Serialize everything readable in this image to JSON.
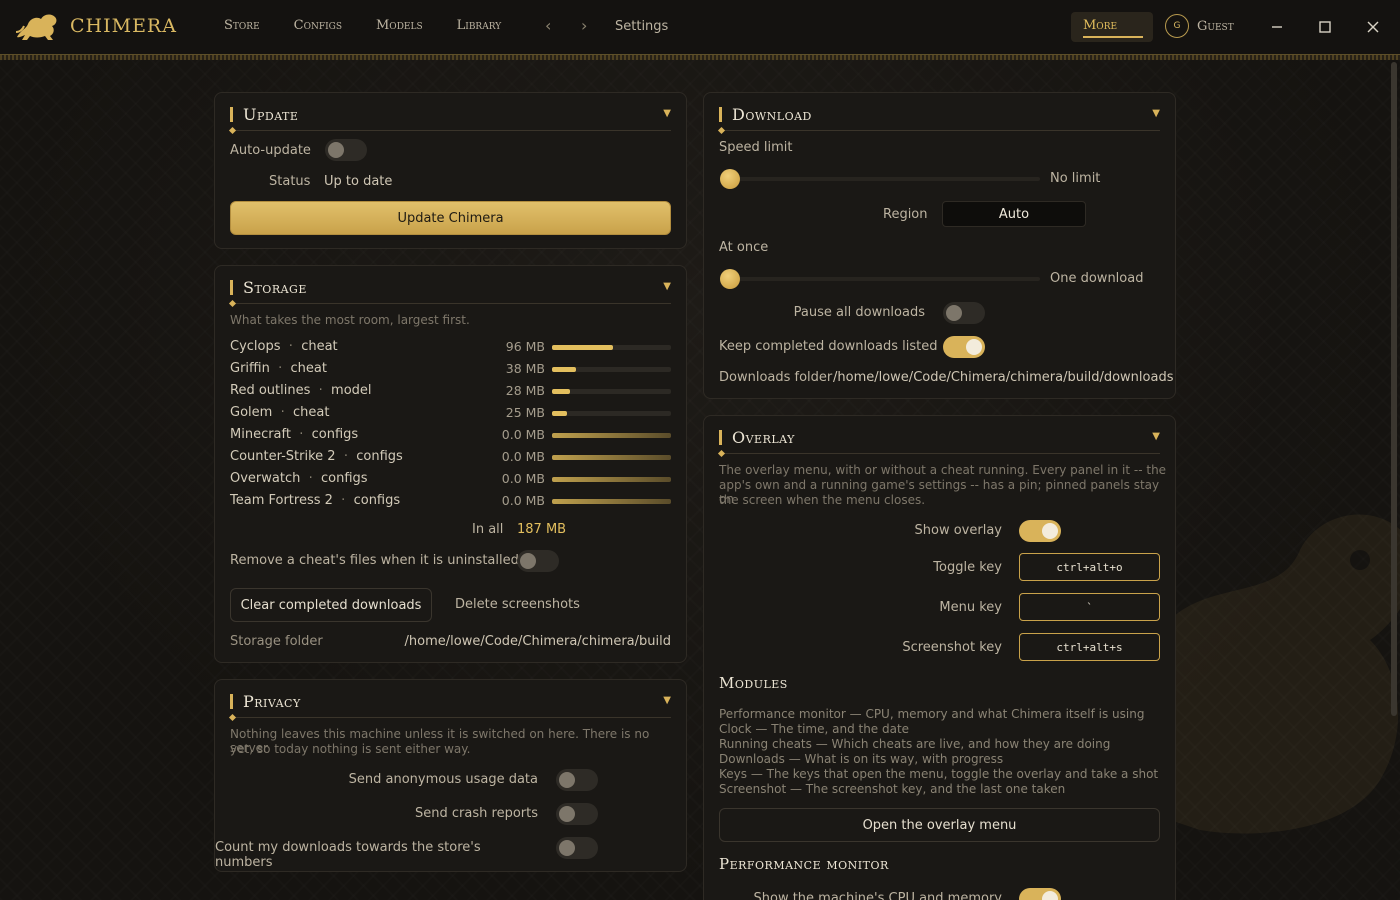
{
  "app": {
    "name": "CHIMERA"
  },
  "nav": [
    "Store",
    "Configs",
    "Models",
    "Library"
  ],
  "breadcrumb": "Settings",
  "topbar": {
    "more_label": "More",
    "user_initial": "G",
    "user_label": "Guest"
  },
  "colors": {
    "accent": "#d9b35a",
    "background": "#171512",
    "panel": "#1a1815"
  },
  "update": {
    "title": "Update",
    "auto_update_label": "Auto-update",
    "auto_update_on": false,
    "status_label": "Status",
    "status_value": "Up to date",
    "button": "Update Chimera"
  },
  "storage": {
    "title": "Storage",
    "subtitle": "What takes the most room, largest first.",
    "items": [
      {
        "name": "Cyclops",
        "kind": "cheat",
        "size": "96 MB",
        "fraction": 0.51
      },
      {
        "name": "Griffin",
        "kind": "cheat",
        "size": "38 MB",
        "fraction": 0.2
      },
      {
        "name": "Red outlines",
        "kind": "model",
        "size": "28 MB",
        "fraction": 0.15
      },
      {
        "name": "Golem",
        "kind": "cheat",
        "size": "25 MB",
        "fraction": 0.13
      },
      {
        "name": "Minecraft",
        "kind": "configs",
        "size": "0.0 MB",
        "fraction": 1.0
      },
      {
        "name": "Counter-Strike 2",
        "kind": "configs",
        "size": "0.0 MB",
        "fraction": 1.0
      },
      {
        "name": "Overwatch",
        "kind": "configs",
        "size": "0.0 MB",
        "fraction": 1.0
      },
      {
        "name": "Team Fortress 2",
        "kind": "configs",
        "size": "0.0 MB",
        "fraction": 1.0
      }
    ],
    "total_label": "In all",
    "total_value": "187 MB",
    "remove_label": "Remove a cheat's files when it is uninstalled",
    "remove_on": false,
    "clear_button": "Clear completed downloads",
    "delete_button": "Delete screenshots",
    "folder_label": "Storage folder",
    "folder_value": "/home/lowe/Code/Chimera/chimera/build"
  },
  "privacy": {
    "title": "Privacy",
    "description_1": "Nothing leaves this machine unless it is switched on here. There is no server",
    "description_2": "yet, so today nothing is sent either way.",
    "usage_label": "Send anonymous usage data",
    "crash_label": "Send crash reports",
    "count_label": "Count my downloads towards the store's numbers"
  },
  "download": {
    "title": "Download",
    "speed_label": "Speed limit",
    "speed_value": "No limit",
    "region_label": "Region",
    "region_value": "Auto",
    "at_once_label": "At once",
    "at_once_value": "One download",
    "pause_label": "Pause all downloads",
    "pause_on": false,
    "keep_label": "Keep completed downloads listed",
    "keep_on": true,
    "folder_label": "Downloads folder",
    "folder_value": "/home/lowe/Code/Chimera/chimera/build/downloads"
  },
  "overlay": {
    "title": "Overlay",
    "description_1": "The overlay menu, with or without a cheat running. Every panel in it -- the",
    "description_2": "app's own and a running game's settings -- has a pin; pinned panels stay on",
    "description_3": "the screen when the menu closes.",
    "show_label": "Show overlay",
    "show_on": true,
    "toggle_key_label": "Toggle key",
    "toggle_key_value": "ctrl+alt+o",
    "menu_key_label": "Menu key",
    "menu_key_value": "`",
    "screenshot_key_label": "Screenshot key",
    "screenshot_key_value": "ctrl+alt+s",
    "modules_title": "Modules",
    "modules": [
      "Performance monitor — CPU, memory and what Chimera itself is using",
      "Clock — The time, and the date",
      "Running cheats — Which cheats are live, and how they are doing",
      "Downloads — What is on its way, with progress",
      "Keys — The keys that open the menu, toggle the overlay and take a shot",
      "Screenshot — The screenshot key, and the last one taken"
    ],
    "open_button": "Open the overlay menu",
    "perf_title": "Performance monitor",
    "perf_show_label": "Show the machine's CPU and memory",
    "perf_show_on": true
  }
}
